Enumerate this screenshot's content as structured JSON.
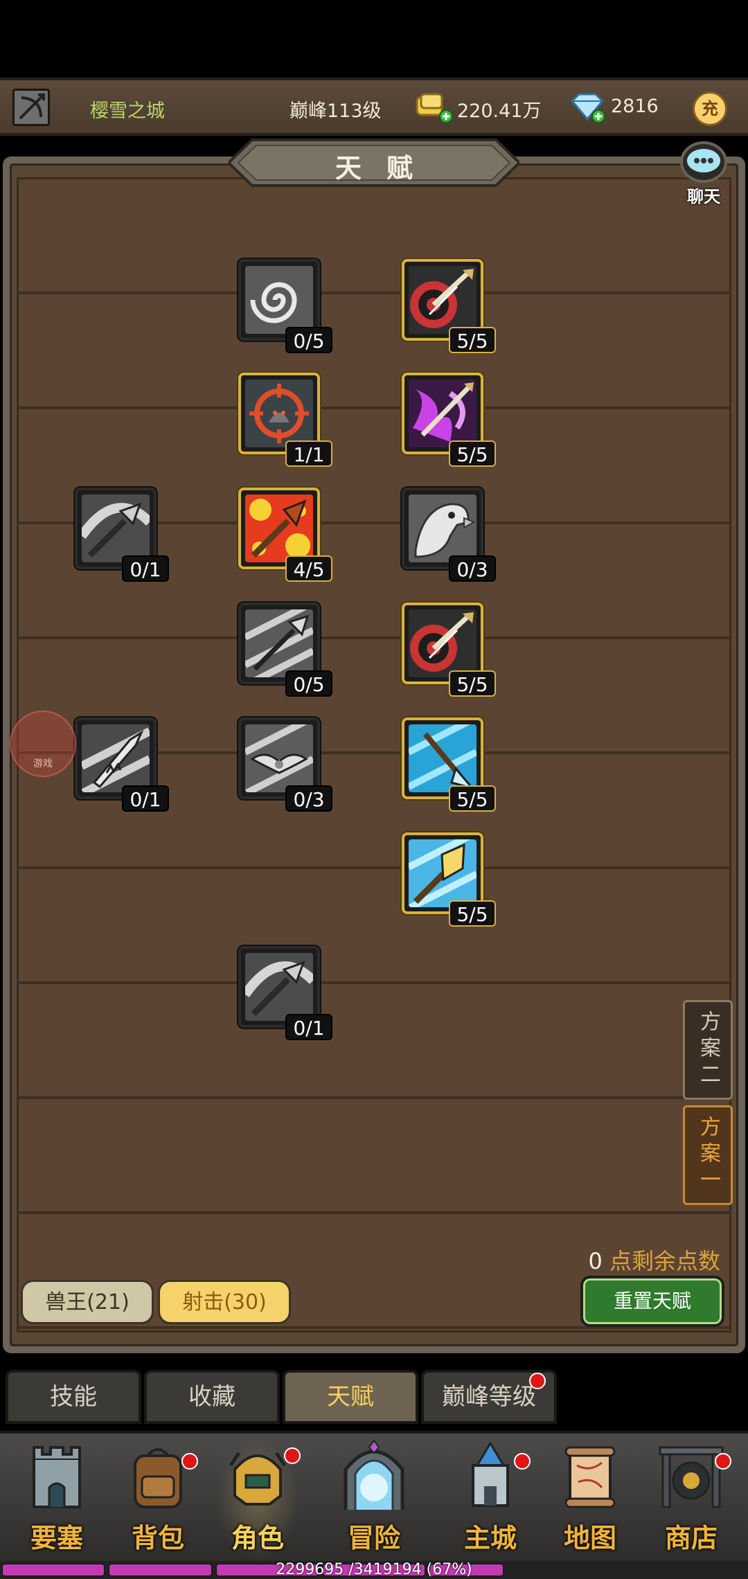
{
  "topbar": {
    "city": "樱雪之城",
    "level": "巅峰113级",
    "gold": "220.41万",
    "diamonds": "2816",
    "charge_label": "充"
  },
  "panel": {
    "title": "天赋",
    "chat_label": "聊天",
    "plan_two": "方案二",
    "plan_one": "方案一",
    "points_num": "0",
    "points_text": "点剩余点数",
    "tree_a": "兽王(21)",
    "tree_b": "射击(30)",
    "reset": "重置天赋"
  },
  "talents": [
    {
      "id": "vortex",
      "count": "0/5",
      "active": false,
      "icon": "vortex-icon"
    },
    {
      "id": "target-arrow-1",
      "count": "5/5",
      "active": true,
      "icon": "target-arrow-icon"
    },
    {
      "id": "crosshair-beast",
      "count": "1/1",
      "active": true,
      "icon": "crosshair-icon"
    },
    {
      "id": "arcane-arrow",
      "count": "5/5",
      "active": true,
      "icon": "arcane-arrow-icon"
    },
    {
      "id": "spear-1",
      "count": "0/1",
      "active": false,
      "icon": "spear-icon"
    },
    {
      "id": "fire-spear",
      "count": "4/5",
      "active": true,
      "icon": "fire-spear-icon"
    },
    {
      "id": "eagle",
      "count": "0/3",
      "active": false,
      "icon": "eagle-icon"
    },
    {
      "id": "swift-arrow",
      "count": "0/5",
      "active": false,
      "icon": "swift-arrow-icon"
    },
    {
      "id": "target-arrow-2",
      "count": "5/5",
      "active": true,
      "icon": "target-arrow-icon"
    },
    {
      "id": "serrated-blade",
      "count": "0/1",
      "active": false,
      "icon": "blade-icon"
    },
    {
      "id": "bat-arrow",
      "count": "0/3",
      "active": false,
      "icon": "bat-icon"
    },
    {
      "id": "ice-arrow",
      "count": "5/5",
      "active": true,
      "icon": "ice-arrow-icon"
    },
    {
      "id": "gold-spear",
      "count": "5/5",
      "active": true,
      "icon": "gold-spear-icon"
    },
    {
      "id": "spear-2",
      "count": "0/1",
      "active": false,
      "icon": "spear-icon"
    }
  ],
  "subtabs": [
    "技能",
    "收藏",
    "天赋",
    "巅峰等级"
  ],
  "nav": [
    "要塞",
    "背包",
    "角色",
    "冒险",
    "主城",
    "地图",
    "商店"
  ],
  "xp": {
    "text": "2299695 /3419194 (67%)",
    "progress": 0.67
  },
  "colors": {
    "active_border": "#d9b13d",
    "reset_green": "#2f7a2c",
    "plan_active": "#f3a637",
    "xp_bar": "#c13ab3"
  }
}
